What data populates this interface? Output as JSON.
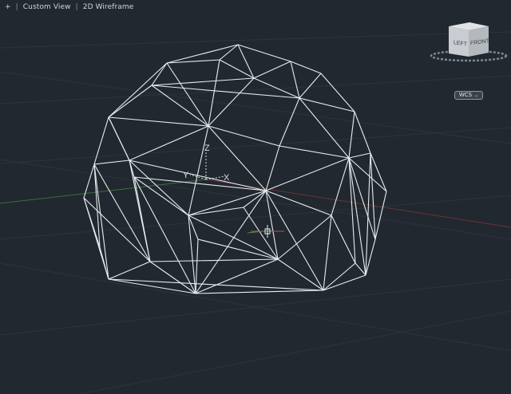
{
  "viewport_controls": {
    "menu_glyph": "+",
    "view_label": "Custom View",
    "visual_style_label": "2D Wireframe"
  },
  "viewcube": {
    "face_left": "LEFT",
    "face_front": "FRONT"
  },
  "wcs_menu": {
    "label": "WCS",
    "chevron": "⌄"
  },
  "ucs_icon": {
    "x_label": "X",
    "y_label": "Y",
    "z_label": "Z"
  },
  "colors": {
    "background": "#212830",
    "wireframe": "#e9edf1",
    "grid": "#2f3741",
    "x_axis": "#7a3a3a",
    "y_axis": "#3f7a3f"
  }
}
